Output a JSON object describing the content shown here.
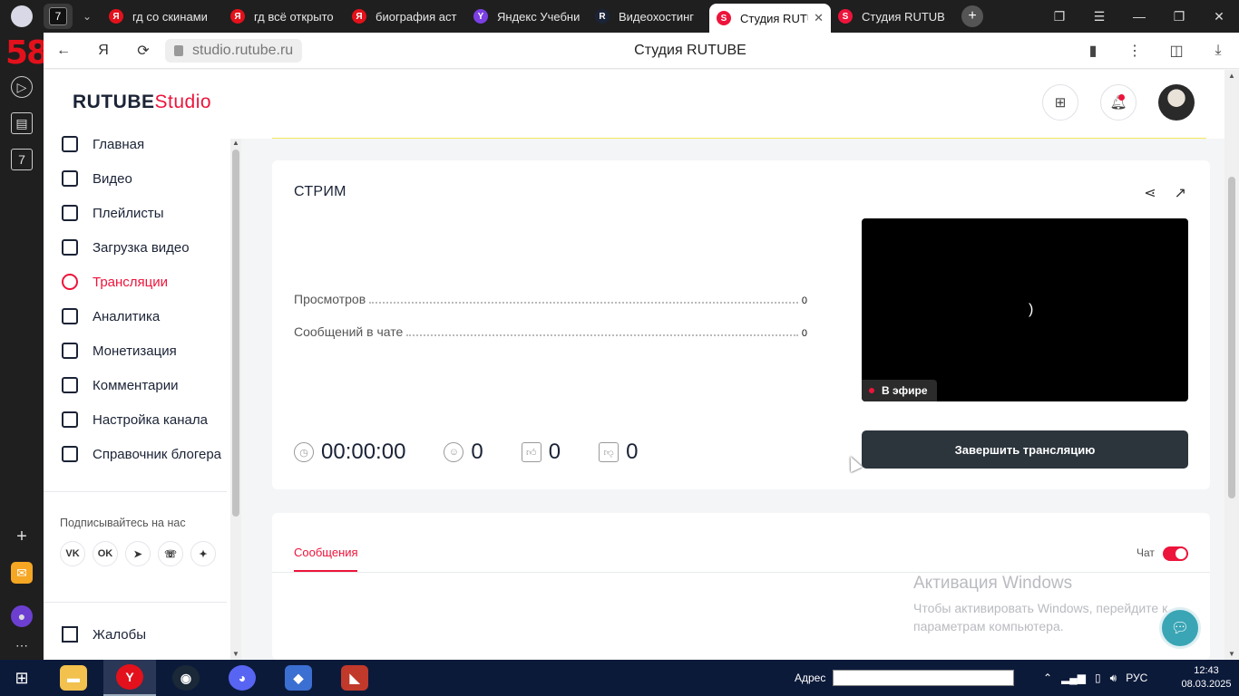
{
  "browser": {
    "tabs": [
      {
        "title": "гд со скинами",
        "icon_color": "#e3111b",
        "icon_letter": "Я"
      },
      {
        "title": "гд всё открыто",
        "icon_color": "#e3111b",
        "icon_letter": "Я"
      },
      {
        "title": "биография аст",
        "icon_color": "#e3111b",
        "icon_letter": "Я"
      },
      {
        "title": "Яндекс Учебни",
        "icon_color": "#7b3fe4",
        "icon_letter": "Y"
      },
      {
        "title": "Видеохостинг",
        "icon_color": "#1b2336",
        "icon_letter": "R"
      },
      {
        "title": "Студия RUTUBE",
        "icon_color": "#ed143b",
        "icon_letter": "S",
        "active": true
      },
      {
        "title": "Студия RUTUB",
        "icon_color": "#ed143b",
        "icon_letter": "S"
      }
    ],
    "tab_group_label": "7",
    "url": "studio.rutube.ru",
    "page_title": "Студия RUTUBE",
    "sidebar_badge": "7"
  },
  "studio": {
    "brand_main": "RUTUBE",
    "brand_suffix": "Studio",
    "nav": [
      {
        "label": "Главная",
        "icon": "home-icon"
      },
      {
        "label": "Видео",
        "icon": "video-icon"
      },
      {
        "label": "Плейлисты",
        "icon": "playlist-icon"
      },
      {
        "label": "Загрузка видео",
        "icon": "upload-icon"
      },
      {
        "label": "Трансляции",
        "icon": "broadcast-icon",
        "active": true
      },
      {
        "label": "Аналитика",
        "icon": "analytics-icon"
      },
      {
        "label": "Монетизация",
        "icon": "ruble-icon"
      },
      {
        "label": "Комментарии",
        "icon": "comment-icon"
      },
      {
        "label": "Настройка канала",
        "icon": "gear-icon"
      },
      {
        "label": "Справочник блогера",
        "icon": "info-icon"
      }
    ],
    "follow_label": "Подписывайтесь на нас",
    "socials": [
      "vk-icon",
      "ok-icon",
      "telegram-icon",
      "viber-icon",
      "dzen-icon"
    ],
    "complaints_label": "Жалобы"
  },
  "stream": {
    "title": "СТРИМ",
    "views_label": "Просмотров",
    "views_value": "0",
    "chat_msgs_label": "Сообщений в чате",
    "chat_msgs_value": "0",
    "duration": "00:00:00",
    "viewers": "0",
    "likes": "0",
    "dislikes": "0",
    "live_label": "В эфире",
    "end_button": "Завершить трансляцию"
  },
  "chat": {
    "tab_messages": "Сообщения",
    "toggle_label": "Чат",
    "toggle_on": true
  },
  "watermark": {
    "title": "Активация Windows",
    "text": "Чтобы активировать Windows, перейдите к параметрам компьютера."
  },
  "taskbar": {
    "address_label": "Адрес",
    "lang": "РУС",
    "time": "12:43",
    "date": "08.03.2025"
  },
  "colors": {
    "accent": "#ed143b",
    "dark_button": "#2c353c",
    "taskbar": "#0c1a3a"
  }
}
